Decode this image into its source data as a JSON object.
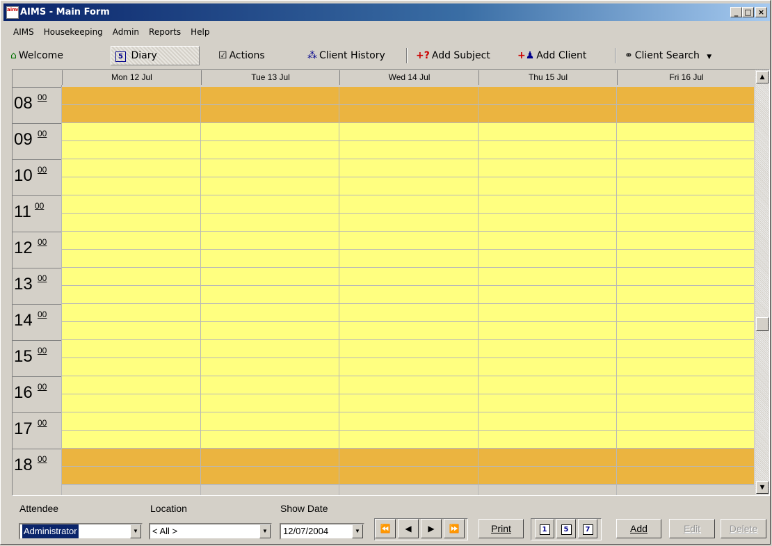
{
  "window": {
    "title": "AIMS - Main Form",
    "icon_text": "aims"
  },
  "menu": [
    "AIMS",
    "Housekeeping",
    "Admin",
    "Reports",
    "Help"
  ],
  "toolbar": {
    "welcome": "Welcome",
    "diary": "Diary",
    "diary_badge": "5",
    "actions": "Actions",
    "client_history": "Client History",
    "add_subject": "Add Subject",
    "add_client": "Add Client",
    "client_search": "Client Search"
  },
  "diary": {
    "days": [
      "Mon 12 Jul",
      "Tue 13 Jul",
      "Wed 14 Jul",
      "Thu 15 Jul",
      "Fri 16 Jul"
    ],
    "hours": [
      "08",
      "09",
      "10",
      "11",
      "12",
      "13",
      "14",
      "15",
      "16",
      "17",
      "18"
    ],
    "minutes": "00",
    "colors": {
      "working": "#ffff80",
      "nonworking": "#ebb440"
    }
  },
  "filters": {
    "attendee_label": "Attendee",
    "attendee_value": "Administrator",
    "location_label": "Location",
    "location_value": "< All >",
    "showdate_label": "Show Date",
    "showdate_value": "12/07/2004"
  },
  "buttons": {
    "print": "Print",
    "add": "Add",
    "edit": "Edit",
    "delete": "Delete",
    "view1": "1",
    "view5": "5",
    "view7": "7"
  }
}
